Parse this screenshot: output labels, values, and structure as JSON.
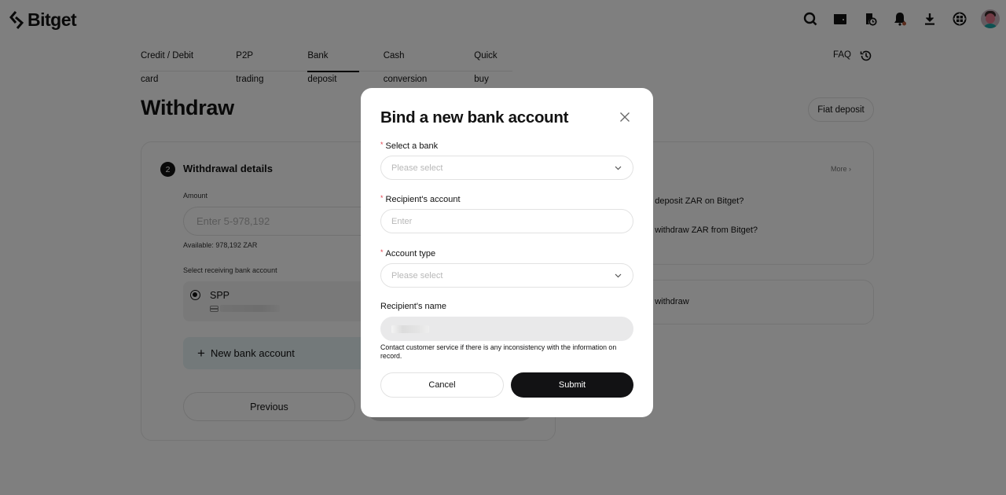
{
  "brand": {
    "name": "Bitget"
  },
  "topbar": {
    "icons": [
      "search-icon",
      "wallet-icon",
      "orders-icon",
      "notification-bell-icon",
      "download-icon",
      "language-globe-icon",
      "user-avatar"
    ]
  },
  "nav": {
    "tabs": [
      {
        "label": "Credit / Debit card",
        "active": false
      },
      {
        "label": "P2P trading",
        "active": false
      },
      {
        "label": "Bank deposit",
        "active": true
      },
      {
        "label": "Cash conversion",
        "active": false
      },
      {
        "label": "Quick buy",
        "active": false
      }
    ],
    "faq_label": "FAQ"
  },
  "page": {
    "title": "Withdraw",
    "fiat_deposit_label": "Fiat deposit"
  },
  "withdrawal": {
    "step_number": "2",
    "step_title": "Withdrawal details",
    "amount_label": "Amount",
    "amount_placeholder": "Enter 5-978,192",
    "available_text": "Available: 978,192 ZAR",
    "receiving_label": "Select receiving bank account",
    "bank_accounts": [
      {
        "name": "SPP",
        "selected": true
      }
    ],
    "new_bank_label": "New bank account",
    "previous_label": "Previous"
  },
  "faq_panel": {
    "more_label": "More",
    "questions": [
      "w to deposit ZAR on Bitget?",
      "w to withdraw ZAR from Bitget?"
    ],
    "guide": "w to withdraw"
  },
  "modal": {
    "title": "Bind a new bank account",
    "fields": {
      "bank": {
        "label": "Select a bank",
        "required": true,
        "placeholder": "Please select"
      },
      "account": {
        "label": "Recipient's account",
        "required": true,
        "placeholder": "Enter"
      },
      "account_type": {
        "label": "Account type",
        "required": true,
        "placeholder": "Please select"
      },
      "name": {
        "label": "Recipient's name",
        "required": false
      }
    },
    "hint": "Contact customer service if there is any inconsistency with the information on record.",
    "cancel_label": "Cancel",
    "submit_label": "Submit"
  },
  "colors": {
    "primary": "#121214",
    "required_star": "#e0424f",
    "new_bank_bg": "#e6f2f4"
  }
}
